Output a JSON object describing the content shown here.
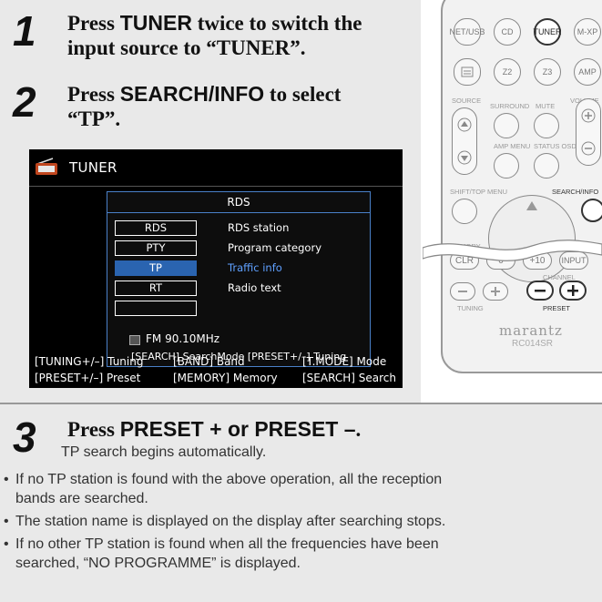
{
  "steps": [
    {
      "number": "1",
      "pre": "Press ",
      "keyword": "TUNER",
      "post": " twice to switch the",
      "line2": "input source to “TUNER”."
    },
    {
      "number": "2",
      "pre": "Press ",
      "keyword": "SEARCH/INFO",
      "post": " to select",
      "line2": "“TP”."
    },
    {
      "number": "3",
      "pre": "Press ",
      "keyword": "PRESET + or PRESET –",
      "post": ".",
      "subtext": "TP search begins automatically."
    }
  ],
  "osd": {
    "header_icon": "radio-icon",
    "title": "TUNER",
    "rds": {
      "title": "RDS",
      "rows": [
        {
          "key": "RDS",
          "desc": "RDS station"
        },
        {
          "key": "PTY",
          "desc": "Program category"
        },
        {
          "key": "TP",
          "desc": "Traffic info"
        },
        {
          "key": "RT",
          "desc": "Radio text"
        },
        {
          "key": "",
          "desc": ""
        }
      ],
      "selected_index": 2,
      "frequency": "FM  90.10MHz",
      "hint": "[SEARCH] SearchMode [PRESET+/–] Tuning"
    },
    "bottom_row1": [
      "[TUNING+/–] Tuning",
      "[BAND]  Band",
      "[T.MODE]  Mode"
    ],
    "bottom_row2": [
      "[PRESET+/–]  Preset",
      "[MEMORY]  Memory",
      "[SEARCH]  Search"
    ],
    "selection_color": "#2a64b0"
  },
  "remote": {
    "row1": [
      "NET/USB",
      "CD",
      "TUNER",
      "M-XP"
    ],
    "row2": [
      "Z2",
      "Z3",
      "AMP"
    ],
    "labels": {
      "source": "SOURCE",
      "surround": "SURROUND",
      "mute": "MUTE",
      "volume": "VOLUME",
      "amp_menu": "AMP MENU",
      "status_osd": "STATUS OSD",
      "shift_top_menu": "SHIFT/TOP MENU",
      "search_info": "SEARCH/INFO",
      "memory": "MEMORY",
      "channel": "CHANNEL",
      "tuning": "TUNING",
      "preset": "PRESET"
    },
    "keys": {
      "clr": "CLR",
      "zero": "0",
      "plus10": "+10",
      "input": "INPUT"
    },
    "brand": "marantz",
    "model": "RC014SR"
  },
  "bullets": [
    "If no TP station is found with the above operation, all the reception",
    "bands are searched.",
    "The station name is displayed on the display after searching stops.",
    "If no other TP station is found when all the frequencies have been",
    "searched, “NO PROGRAMME” is displayed."
  ]
}
